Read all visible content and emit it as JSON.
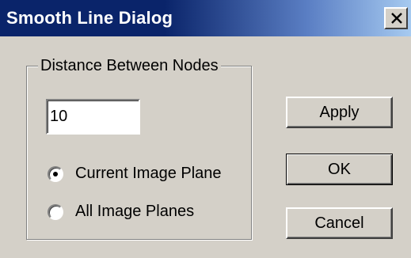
{
  "window": {
    "title": "Smooth Line Dialog",
    "close_icon": "close-icon"
  },
  "group": {
    "legend": "Distance Between Nodes",
    "distance_value": "10"
  },
  "radios": {
    "current": {
      "label": "Current Image Plane",
      "selected": true
    },
    "all": {
      "label": "All Image Planes",
      "selected": false
    }
  },
  "buttons": {
    "apply": "Apply",
    "ok": "OK",
    "cancel": "Cancel"
  },
  "colors": {
    "title_bar": "#0a246a",
    "title_bar_end": "#a6caf0",
    "dialog_bg": "#d4d0c8"
  }
}
